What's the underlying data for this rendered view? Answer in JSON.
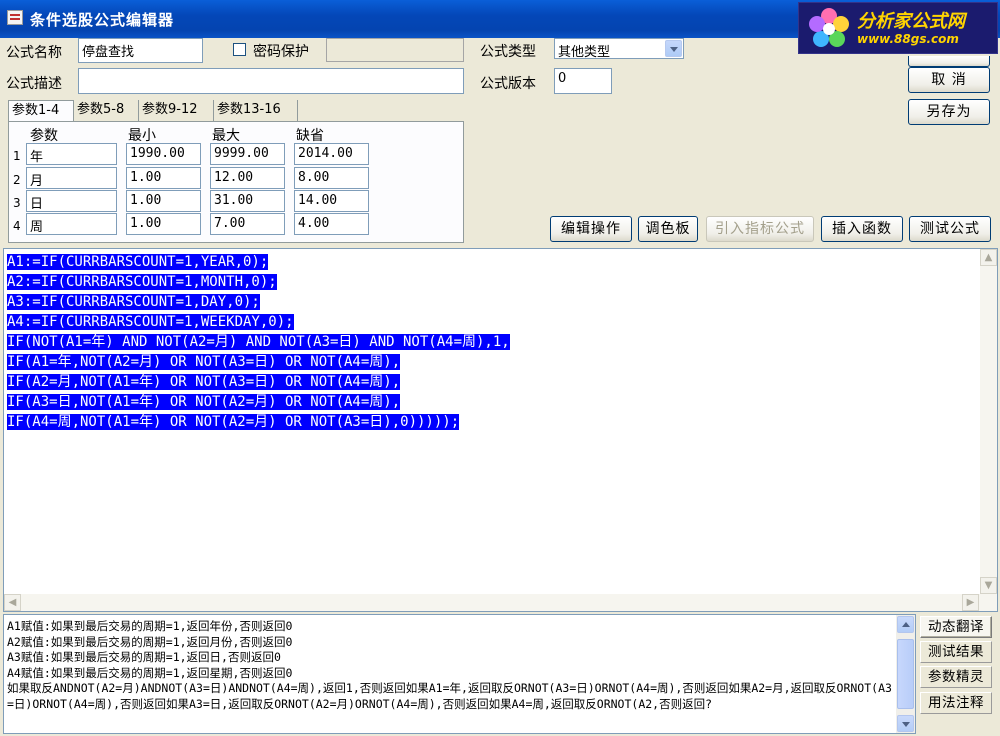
{
  "window": {
    "title": "条件选股公式编辑器",
    "app_icon": "window-app-icon"
  },
  "logo": {
    "name": "分析家公式网",
    "url": "www.88gs.com"
  },
  "form": {
    "name_label": "公式名称",
    "name_value": "停盘查找",
    "password_label": "密码保护",
    "password_checked": false,
    "password_value": "",
    "type_label": "公式类型",
    "type_value": "其他类型",
    "desc_label": "公式描述",
    "desc_value": "",
    "version_label": "公式版本",
    "version_value": "0"
  },
  "buttons": {
    "ok": "",
    "cancel": "取  消",
    "save_as": "另存为",
    "edit_ops": "编辑操作",
    "palette": "调色板",
    "import_indicator": "引入指标公式",
    "insert_function": "插入函数",
    "test_formula": "测试公式"
  },
  "param_tabs": [
    "参数1-4",
    "参数5-8",
    "参数9-12",
    "参数13-16"
  ],
  "param_table": {
    "headers": [
      "参数",
      "最小",
      "最大",
      "缺省"
    ],
    "rows": [
      {
        "num": "1",
        "name": "年",
        "min": "1990.00",
        "max": "9999.00",
        "default": "2014.00"
      },
      {
        "num": "2",
        "name": "月",
        "min": "1.00",
        "max": "12.00",
        "default": "8.00"
      },
      {
        "num": "3",
        "name": "日",
        "min": "1.00",
        "max": "31.00",
        "default": "14.00"
      },
      {
        "num": "4",
        "name": "周",
        "min": "1.00",
        "max": "7.00",
        "default": "4.00"
      }
    ]
  },
  "code_lines": [
    "A1:=IF(CURRBARSCOUNT=1,YEAR,0);",
    "A2:=IF(CURRBARSCOUNT=1,MONTH,0);",
    "A3:=IF(CURRBARSCOUNT=1,DAY,0);",
    "A4:=IF(CURRBARSCOUNT=1,WEEKDAY,0);",
    "IF(NOT(A1=年) AND NOT(A2=月) AND NOT(A3=日) AND NOT(A4=周),1,",
    "IF(A1=年,NOT(A2=月) OR NOT(A3=日) OR NOT(A4=周),",
    "IF(A2=月,NOT(A1=年) OR NOT(A3=日) OR NOT(A4=周),",
    "IF(A3=日,NOT(A1=年) OR NOT(A2=月) OR NOT(A4=周),",
    "IF(A4=周,NOT(A1=年) OR NOT(A2=月) OR NOT(A3=日),0)))));"
  ],
  "explain_lines": [
    "A1赋值:如果到最后交易的周期=1,返回年份,否则返回0",
    "A2赋值:如果到最后交易的周期=1,返回月份,否则返回0",
    "A3赋值:如果到最后交易的周期=1,返回日,否则返回0",
    "A4赋值:如果到最后交易的周期=1,返回星期,否则返回0",
    "如果取反ANDNOT(A2=月)ANDNOT(A3=日)ANDNOT(A4=周),返回1,否则返回如果A1=年,返回取反ORNOT(A3=日)ORNOT(A4=周),否则返回如果A2=月,返回取反ORNOT(A3=日)ORNOT(A4=周),否则返回如果A3=日,返回取反ORNOT(A2=月)ORNOT(A4=周),否则返回如果A4=周,返回取反ORNOT(A2,否则返回?"
  ],
  "side_buttons": [
    "动态翻译",
    "测试结果",
    "参数精灵",
    "用法注释"
  ],
  "colors": {
    "selection": "#0000ff",
    "titlebar": "#0447b8",
    "logo_bg": "#1b1b6e",
    "logo_text": "#ffd400"
  }
}
